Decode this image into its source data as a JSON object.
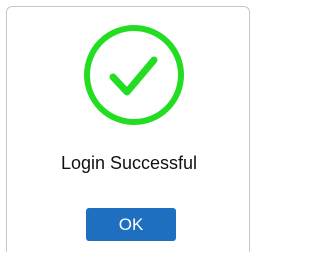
{
  "dialog": {
    "icon": "checkmark-circle-icon",
    "icon_color": "#22dd22",
    "message": "Login Successful",
    "ok_label": "OK",
    "button_color": "#1e6fc0"
  }
}
